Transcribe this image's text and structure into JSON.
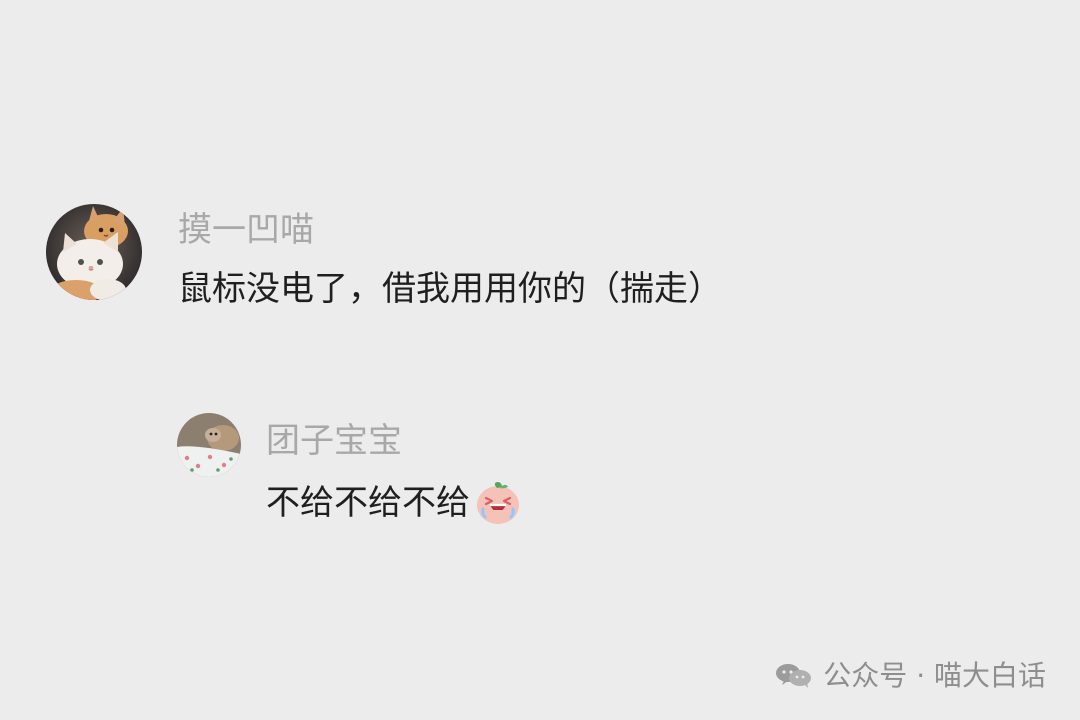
{
  "comments": [
    {
      "username": "摸一凹喵",
      "message": "鼠标没电了，借我用用你的（揣走）",
      "avatar_icon": "cat-avatar-icon"
    }
  ],
  "replies": [
    {
      "username": "团子宝宝",
      "message": "不给不给不给",
      "avatar_icon": "pet-avatar-icon",
      "emoji_icon": "crying-face-icon"
    }
  ],
  "footer": {
    "icon": "wechat-icon",
    "label": "公众号 · 喵大白话"
  },
  "colors": {
    "background": "#ececec",
    "username": "#a8a8a8",
    "message": "#1f1f1f",
    "footer": "#8e8e8e"
  }
}
